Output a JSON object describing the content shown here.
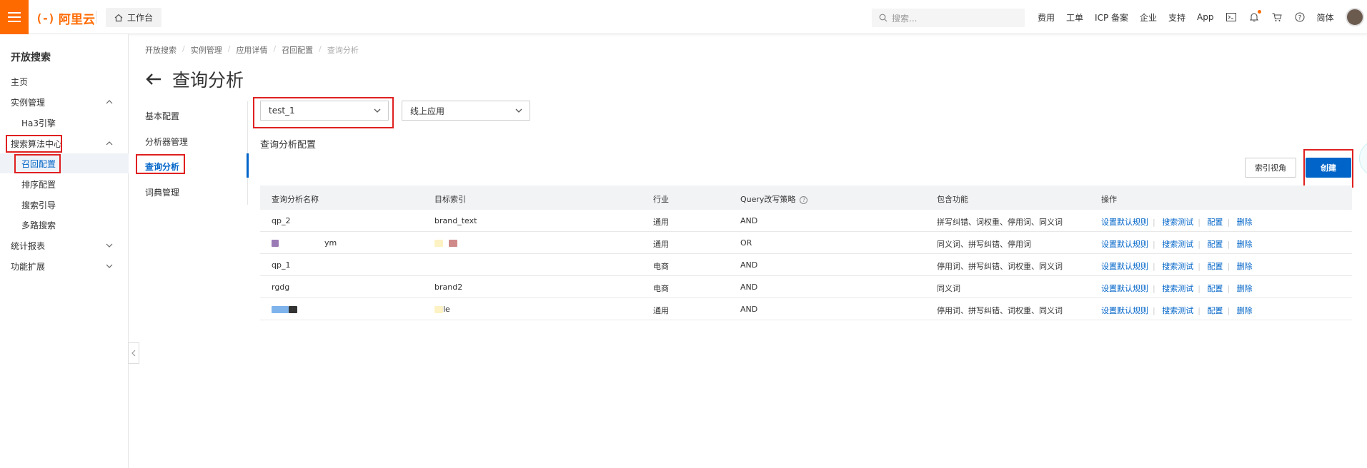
{
  "topbar": {
    "logo": "阿里云",
    "workbench": "工作台",
    "search_placeholder": "搜索...",
    "nav": [
      "费用",
      "工单",
      "ICP 备案",
      "企业",
      "支持",
      "App"
    ],
    "lang": "简体"
  },
  "sidebar": {
    "title": "开放搜索",
    "items": [
      {
        "label": "主页"
      },
      {
        "label": "实例管理"
      },
      {
        "label": "Ha3引擎"
      },
      {
        "label": "搜索算法中心"
      },
      {
        "label": "召回配置"
      },
      {
        "label": "排序配置"
      },
      {
        "label": "搜索引导"
      },
      {
        "label": "多路搜索"
      },
      {
        "label": "统计报表"
      },
      {
        "label": "功能扩展"
      }
    ]
  },
  "breadcrumb": [
    "开放搜索",
    "实例管理",
    "应用详情",
    "召回配置",
    "查询分析"
  ],
  "page_title": "查询分析",
  "subnav": [
    "基本配置",
    "分析器管理",
    "查询分析",
    "词典管理"
  ],
  "selects": {
    "app": "test_1",
    "env": "线上应用"
  },
  "section_title": "查询分析配置",
  "buttons": {
    "index_view": "索引视角",
    "create": "创建"
  },
  "table": {
    "headers": [
      "查询分析名称",
      "目标索引",
      "行业",
      "Query改写策略",
      "包含功能",
      "操作"
    ],
    "header_help_icon": "?",
    "rows": [
      {
        "name": "qp_2",
        "index": "brand_text",
        "industry": "通用",
        "strategy": "AND",
        "features": "拼写纠错、词权重、停用词、同义词"
      },
      {
        "name": "ym",
        "index": "",
        "industry": "通用",
        "strategy": "OR",
        "features": "同义词、拼写纠错、停用词"
      },
      {
        "name": "qp_1",
        "index": "",
        "industry": "电商",
        "strategy": "AND",
        "features": "停用词、拼写纠错、词权重、同义词"
      },
      {
        "name": "rgdg",
        "index": "brand2",
        "industry": "电商",
        "strategy": "AND",
        "features": "同义词"
      },
      {
        "name": "",
        "index": "le",
        "industry": "通用",
        "strategy": "AND",
        "features": "停用词、拼写纠错、词权重、同义词"
      }
    ],
    "actions": [
      "设置默认规则",
      "搜索测试",
      "配置",
      "删除"
    ]
  }
}
